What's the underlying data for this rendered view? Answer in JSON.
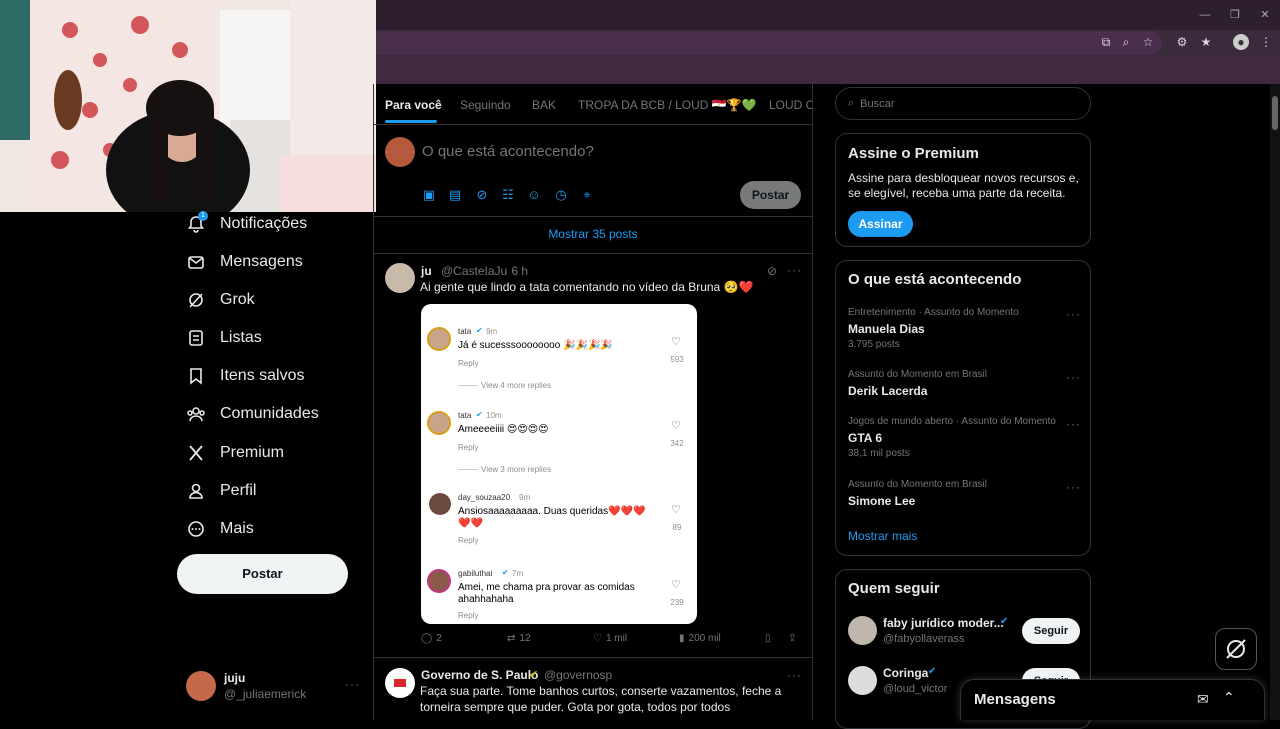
{
  "nav": {
    "notifications": "Notificações",
    "notifications_badge": "1",
    "messages": "Mensagens",
    "grok": "Grok",
    "lists": "Listas",
    "bookmarks": "Itens salvos",
    "communities": "Comunidades",
    "premium": "Premium",
    "profile": "Perfil",
    "more": "Mais",
    "post_button": "Postar"
  },
  "account": {
    "name": "juju",
    "handle": "@_juliaemerick"
  },
  "tabs": [
    "Para você",
    "Seguindo",
    "BAK",
    "TROPA DA BCB / LOUD 🇪🇬🏆💚",
    "LOUD Co"
  ],
  "composer": {
    "placeholder": "O que está acontecendo?",
    "post_label": "Postar"
  },
  "show_posts": "Mostrar 35 posts",
  "post1": {
    "name": "ju",
    "handle": "@CasteIaJu",
    "time": "· 6 h",
    "text": "Ai gente que lindo a tata comentando no vídeo da Bruna 🥺❤️",
    "stats": {
      "replies": "2",
      "reposts": "12",
      "likes": "1 mil",
      "views": "200 mil"
    },
    "embed": {
      "comments": [
        {
          "user": "tata",
          "time": "9m",
          "text": "Já é sucesssoooooooo 🎉🎉🎉🎉",
          "likes": "593",
          "reply": "Reply",
          "more": "View 4 more replies"
        },
        {
          "user": "tata",
          "time": "10m",
          "text": "Ameeeeiiii 😍😍😍😍",
          "likes": "342",
          "reply": "Reply",
          "more": "View 3 more replies"
        },
        {
          "user": "day_souzaa20",
          "time": "9m",
          "text": "Ansiosaaaaaaaaa. Duas queridas❤️❤️❤️",
          "text2": "❤️❤️",
          "likes": "89",
          "reply": "Reply"
        },
        {
          "user": "gabiluthai",
          "time": "7m",
          "text": "Amei, me chama pra provar as comidas",
          "text2": "ahahhahaha",
          "likes": "239",
          "reply": "Reply"
        }
      ]
    }
  },
  "post2": {
    "name": "Governo de S. Paulo",
    "handle": "@governosp",
    "text": "Faça sua parte. Tome banhos curtos, conserte vazamentos, feche a",
    "text2": "torneira sempre que puder. Gota por gota, todos por todos"
  },
  "search": {
    "placeholder": "Buscar"
  },
  "premium_box": {
    "title": "Assine o Premium",
    "body": "Assine para desbloquear novos recursos e, se elegível, receba uma parte da receita.",
    "button": "Assinar"
  },
  "trends": {
    "title": "O que está acontecendo",
    "items": [
      {
        "meta": "Entretenimento · Assunto do Momento",
        "name": "Manuela Dias",
        "count": "3.795 posts"
      },
      {
        "meta": "Assunto do Momento em Brasil",
        "name": "Derik Lacerda",
        "count": ""
      },
      {
        "meta": "Jogos de mundo aberto · Assunto do Momento",
        "name": "GTA 6",
        "count": "38,1 mil posts"
      },
      {
        "meta": "Assunto do Momento em Brasil",
        "name": "Simone Lee",
        "count": ""
      }
    ],
    "show_more": "Mostrar mais"
  },
  "who_to_follow": {
    "title": "Quem seguir",
    "items": [
      {
        "name": "faby jurídico moder...",
        "handle": "@fabyollaverass",
        "button": "Seguir"
      },
      {
        "name": "Coringa",
        "handle": "@loud_victor",
        "button": "Seguir"
      }
    ]
  },
  "messages_drawer": {
    "title": "Mensagens"
  },
  "colors": {
    "accent": "#1d9bf0",
    "background": "#000000",
    "border": "#2f3336",
    "like_red": "#f91880"
  }
}
